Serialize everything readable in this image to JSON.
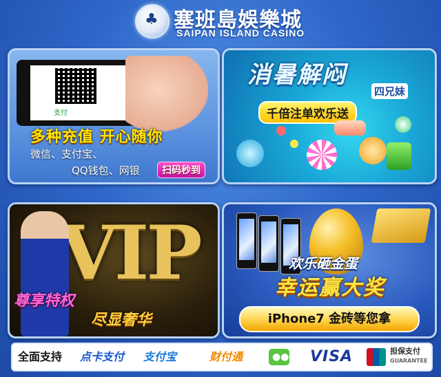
{
  "header": {
    "title_cn": "塞班島娛樂城",
    "title_en": "SAIPAN ISLAND CASINO"
  },
  "panel_recharge": {
    "qr_label": "支付",
    "headline": "多种充值  开心随你",
    "line1": "微信、支付宝、",
    "line2": "QQ钱包、网银",
    "scan_button": "扫码秒到"
  },
  "panel_summer": {
    "headline": "消暑解闷",
    "subtitle": "四兄妹",
    "banner": "千倍注单欢乐送"
  },
  "panel_vip": {
    "logo_text": "VIP",
    "line1": "尊享特权",
    "line2": "尽显奢华"
  },
  "panel_egg": {
    "line1": "欢乐砸金蛋",
    "line2": "幸运赢大奖",
    "bar_text": "iPhone7 金砖等您拿"
  },
  "footer": {
    "lead": "全面支持",
    "p1": "点卡支付",
    "p2": "支付宝",
    "p3": "财付通",
    "wechat_glyph": "●●",
    "visa": "VISA",
    "unionpay_line1": "担保支付",
    "unionpay_line2": "GUARANTEE"
  },
  "colors": {
    "background": "#2f67c9",
    "accent_yellow": "#ffe640",
    "accent_pink": "#ff66d7"
  }
}
